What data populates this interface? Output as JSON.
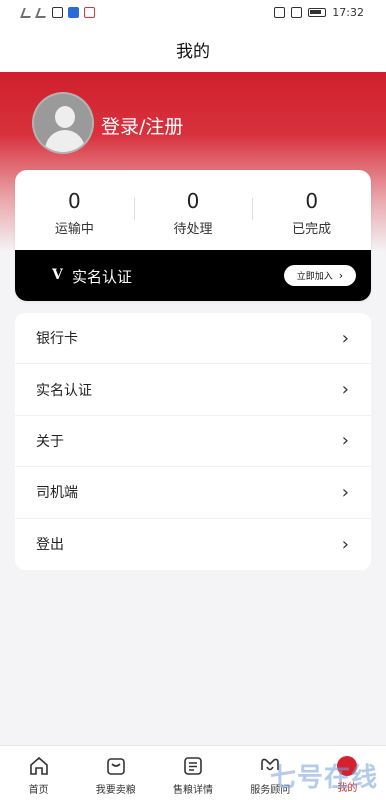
{
  "status_bar": {
    "time": "17:32"
  },
  "header": {
    "title": "我的"
  },
  "user": {
    "login_text": "登录/注册"
  },
  "stats": [
    {
      "value": "0",
      "label": "运输中"
    },
    {
      "value": "0",
      "label": "待处理"
    },
    {
      "value": "0",
      "label": "已完成"
    }
  ],
  "verify": {
    "mark": "V",
    "title": "实名认证",
    "button": "立即加入",
    "arrow": "›"
  },
  "menu": [
    {
      "label": "银行卡",
      "arrow": "›"
    },
    {
      "label": "实名认证",
      "arrow": "›"
    },
    {
      "label": "关于",
      "arrow": "›"
    },
    {
      "label": "司机端",
      "arrow": "›"
    },
    {
      "label": "登出",
      "arrow": "›"
    }
  ],
  "tabs": [
    {
      "label": "首页",
      "icon": "home-icon"
    },
    {
      "label": "我要卖粮",
      "icon": "bag-icon"
    },
    {
      "label": "售粮详情",
      "icon": "list-icon"
    },
    {
      "label": "服务顾问",
      "icon": "service-icon"
    },
    {
      "label": "我的",
      "icon": "profile-icon"
    }
  ],
  "watermark": "七号在线",
  "colors": {
    "brand_red": "#cf1f2c",
    "verify_bar": "#000000"
  }
}
